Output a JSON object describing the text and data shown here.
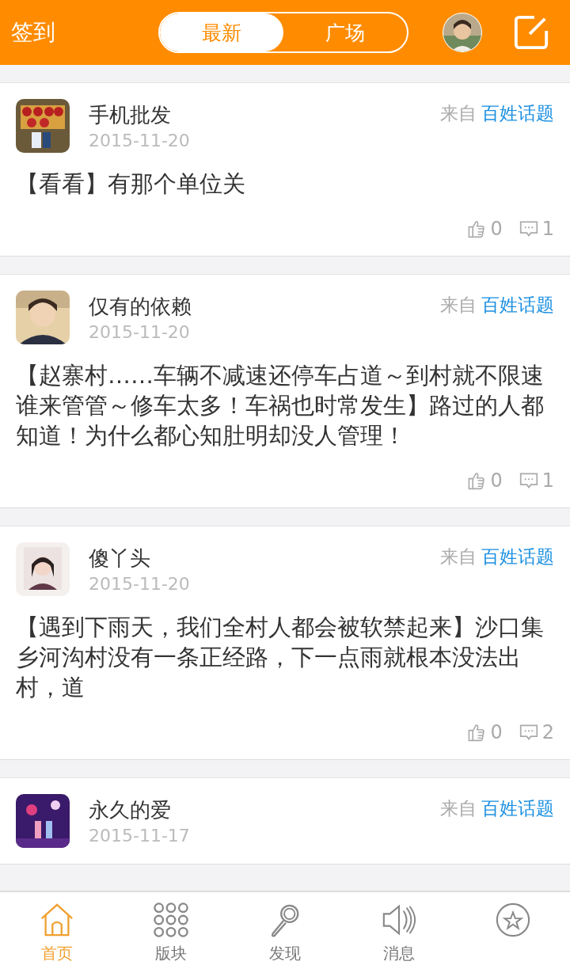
{
  "header": {
    "checkin": "签到",
    "tabs": [
      {
        "label": "最新",
        "selected": true
      },
      {
        "label": "广场",
        "selected": false
      }
    ]
  },
  "posts": [
    {
      "author": "手机批发",
      "date": "2015-11-20",
      "source_prefix": "来自",
      "source": "百姓话题",
      "content": "【看看】有那个单位关",
      "likes": "0",
      "comments": "1"
    },
    {
      "author": "仅有的依赖",
      "date": "2015-11-20",
      "source_prefix": "来自",
      "source": "百姓话题",
      "content": "【赵寨村……车辆不减速还停车占道～到村就不限速谁来管管～修车太多！车祸也时常发生】路过的人都知道！为什么都心知肚明却没人管理！",
      "likes": "0",
      "comments": "1"
    },
    {
      "author": "傻丫头",
      "date": "2015-11-20",
      "source_prefix": "来自",
      "source": "百姓话题",
      "content": "【遇到下雨天，我们全村人都会被软禁起来】沙口集乡河沟村没有一条正经路，下一点雨就根本没法出村，道",
      "likes": "0",
      "comments": "2"
    },
    {
      "author": "永久的爱",
      "date": "2015-11-17",
      "source_prefix": "来自",
      "source": "百姓话题"
    }
  ],
  "nav": [
    {
      "kind": "home",
      "label": "首页",
      "selected": true
    },
    {
      "kind": "grid",
      "label": "版块",
      "selected": false
    },
    {
      "kind": "search",
      "label": "发现",
      "selected": false
    },
    {
      "kind": "speaker",
      "label": "消息",
      "selected": false
    },
    {
      "kind": "star",
      "selected": false
    }
  ]
}
